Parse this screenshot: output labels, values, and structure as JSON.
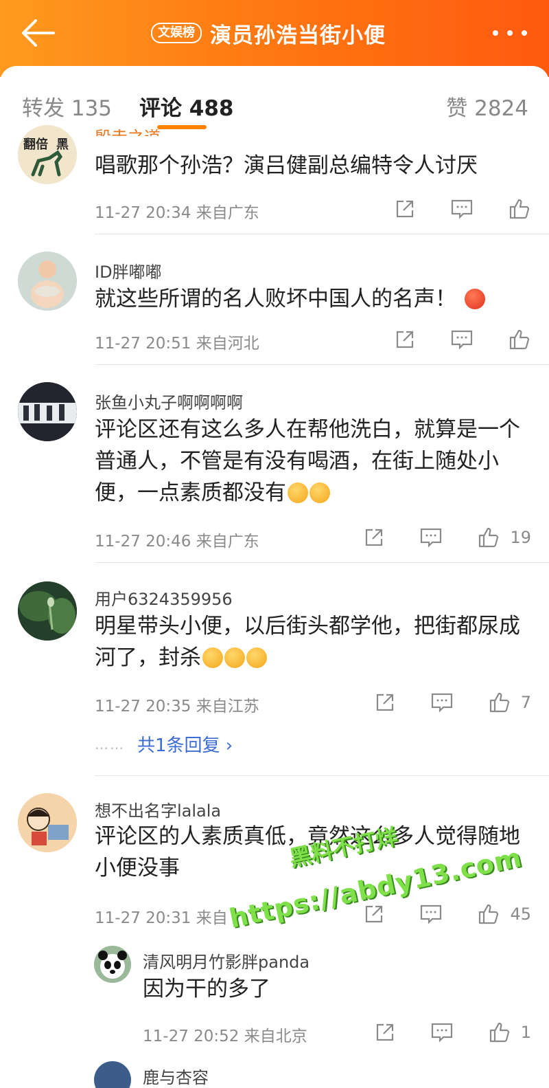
{
  "header": {
    "badge": "文娱榜",
    "title": "演员孙浩当街小便",
    "icons": {
      "back": "arrow-left-icon",
      "more": "more-dots-icon"
    }
  },
  "tabs": {
    "forward": "转发 135",
    "comments": "评论 488",
    "likes": "赞 2824"
  },
  "comments": [
    {
      "name": "殷走之道",
      "text": "唱歌那个孙浩？演吕健副总编特令人讨厌",
      "time": "11-27 20:34",
      "location": "来自广东",
      "likes": ""
    },
    {
      "name": "ID胖嘟嘟",
      "text": "就这些所谓的名人败坏中国人的名声！",
      "time": "11-27 20:51",
      "location": "来自河北",
      "likes": ""
    },
    {
      "name": "张鱼小丸子啊啊啊啊",
      "text": "评论区还有这么多人在帮他洗白，就算是一个普通人，不管是有没有喝酒，在街上随处小便，一点素质都没有",
      "time": "11-27 20:46",
      "location": "来自广东",
      "likes": "19"
    },
    {
      "name": "用户6324359956",
      "text": "明星带头小便，以后街头都学他，把街都尿成河了，封杀",
      "time": "11-27 20:35",
      "location": "来自江苏",
      "likes": "7",
      "replies": "共1条回复 ›"
    },
    {
      "name": "想不出名字lalala",
      "text": "评论区的人素质真低，竟然这么多人觉得随地小便没事",
      "time": "11-27 20:31",
      "location": "来自",
      "likes": "45"
    }
  ],
  "reply": {
    "name": "清风明月竹影胖panda",
    "text": "因为干的多了",
    "time": "11-27 20:52",
    "location": "来自北京",
    "likes": "1"
  },
  "partial_next": {
    "name": "鹿与杏容"
  },
  "watermark": {
    "line1": "黑料不打烊",
    "line2": "https://abdy13.com"
  },
  "colors": {
    "header": "#ff7a12",
    "accent": "#ff8200",
    "link": "#3b6dd2"
  }
}
